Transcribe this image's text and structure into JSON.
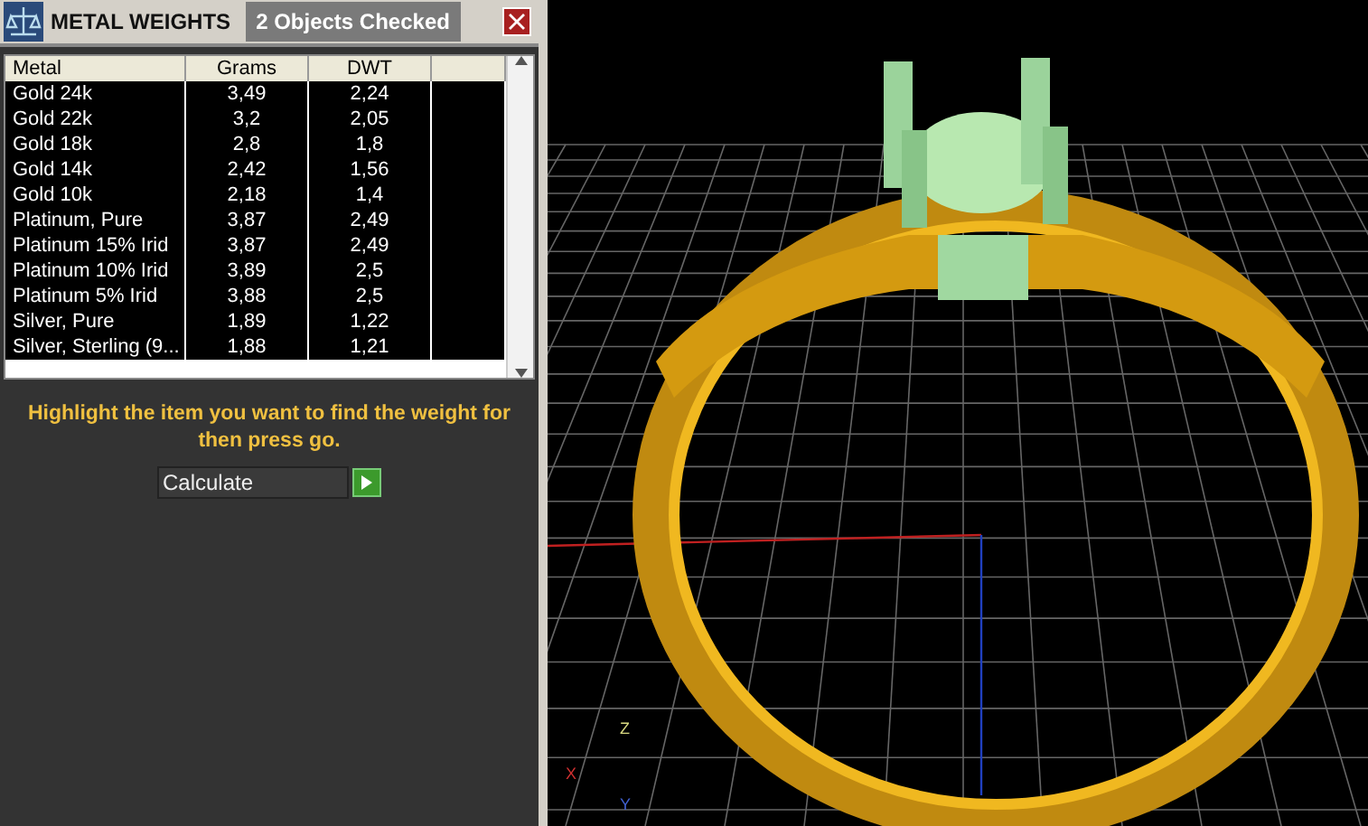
{
  "panel": {
    "title": "METAL WEIGHTS",
    "status": "2 Objects Checked"
  },
  "table": {
    "columns": [
      "Metal",
      "Grams",
      "DWT"
    ],
    "rows": [
      {
        "cells": [
          "Gold 24k",
          "3,49",
          "2,24"
        ],
        "selected": true
      },
      {
        "cells": [
          "Gold 22k",
          "3,2",
          "2,05"
        ],
        "selected": true
      },
      {
        "cells": [
          "Gold 18k",
          "2,8",
          "1,8"
        ],
        "selected": true
      },
      {
        "cells": [
          "Gold 14k",
          "2,42",
          "1,56"
        ],
        "selected": true
      },
      {
        "cells": [
          "Gold 10k",
          "2,18",
          "1,4"
        ],
        "selected": true
      },
      {
        "cells": [
          "Platinum, Pure",
          "3,87",
          "2,49"
        ],
        "selected": true
      },
      {
        "cells": [
          "Platinum 15% Irid",
          "3,87",
          "2,49"
        ],
        "selected": true
      },
      {
        "cells": [
          "Platinum 10% Irid",
          "3,89",
          "2,5"
        ],
        "selected": true
      },
      {
        "cells": [
          "Platinum 5% Irid",
          "3,88",
          "2,5"
        ],
        "selected": true
      },
      {
        "cells": [
          "Silver, Pure",
          "1,89",
          "1,22"
        ],
        "selected": true
      },
      {
        "cells": [
          "Silver, Sterling (9...",
          "1,88",
          "1,21"
        ],
        "selected": true
      }
    ]
  },
  "instruction": "Highlight the item you want to find the weight for then press go.",
  "action": {
    "value": "Calculate"
  },
  "axes": {
    "z": "Z",
    "x": "X",
    "y": "Y"
  }
}
